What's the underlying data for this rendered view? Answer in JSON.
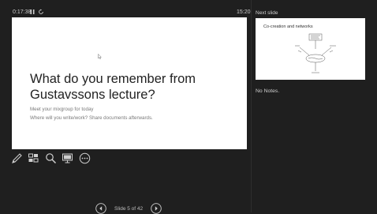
{
  "toolbar": {
    "elapsed_time": "0:17:38",
    "pause_icon": "pause-icon",
    "restart_icon": "restart-icon",
    "clock": "15:20"
  },
  "current_slide": {
    "title": "What do you remember from Gustavssons lecture?",
    "line1": "Meet your mixgroup for today",
    "line2": "Where will you write/work? Share documents afterwards."
  },
  "tools": [
    {
      "icon": "pen-icon"
    },
    {
      "icon": "slides-grid-icon"
    },
    {
      "icon": "zoom-icon"
    },
    {
      "icon": "screen-icon"
    },
    {
      "icon": "more-options-icon"
    }
  ],
  "next_slide": {
    "label": "Next slide",
    "title": "Co-creation and networks"
  },
  "notes": {
    "text": "No Notes."
  },
  "navigation": {
    "slide_counter": "Slide 5 of 42",
    "current": 5,
    "total": 42
  },
  "colors": {
    "background": "#1f1f1f",
    "text": "#d6d6d6",
    "slide_background": "#ffffff"
  }
}
